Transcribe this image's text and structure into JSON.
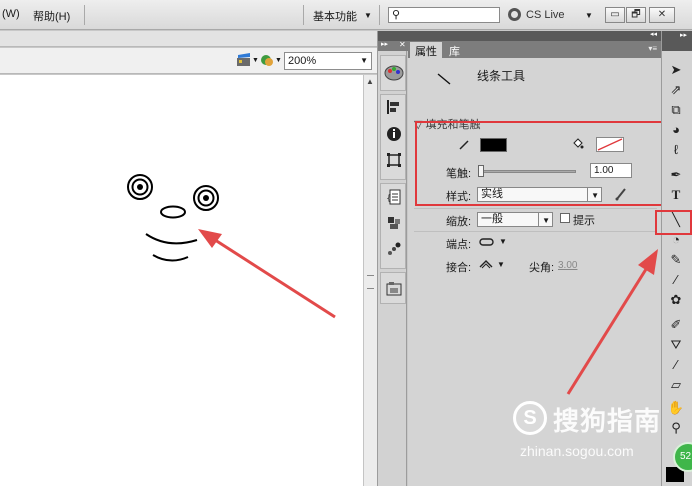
{
  "menu": {
    "item_w": "(W)",
    "item_help": "帮助(H)",
    "workspace": "基本功能",
    "cs_live": "CS Live"
  },
  "window_controls": {
    "minimize": "▭",
    "restore": "🗗",
    "close": "✕"
  },
  "stage": {
    "zoom": "200%"
  },
  "properties": {
    "tab_properties": "属性",
    "tab_library": "库",
    "tool_name": "线条工具",
    "section_fill_stroke": "填充和笔触",
    "stroke_label": "笔触:",
    "stroke_width": "1.00",
    "style_label": "样式:",
    "style_value": "实线",
    "scale_label": "缩放:",
    "scale_value": "一般",
    "hint_label": "提示",
    "cap_label": "端点:",
    "join_label": "接合:",
    "miter_label": "尖角:",
    "miter_value": "3.00"
  },
  "colors": {
    "highlight": "#e0383c",
    "stroke_color": "#000000",
    "arrow": "#e24a4a"
  },
  "watermark": {
    "badge": "S",
    "brand": "搜狗指南",
    "url": "zhinan.sogou.com"
  },
  "badge": "52"
}
